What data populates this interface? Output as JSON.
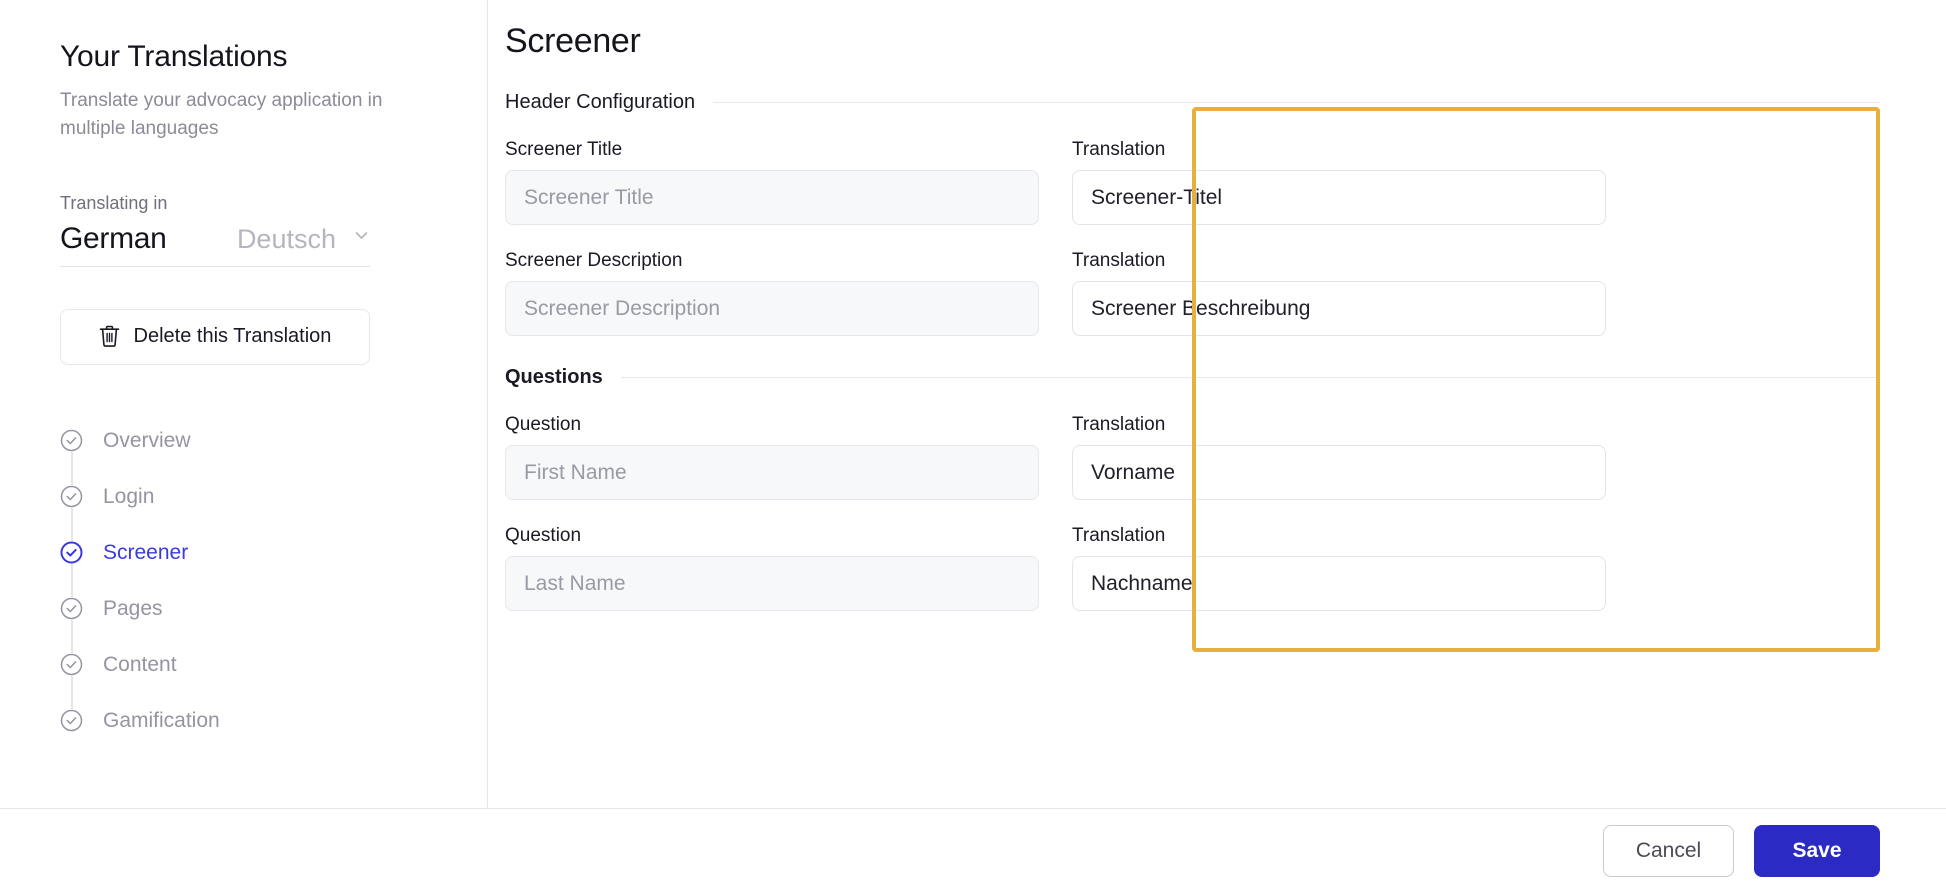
{
  "sidebar": {
    "title": "Your Translations",
    "subtitle": "Translate your advocacy application in multiple languages",
    "translating_label": "Translating in",
    "language": {
      "name": "German",
      "native": "Deutsch",
      "chevron_icon": "chevron-down-icon"
    },
    "delete_button": {
      "label": "Delete this Translation",
      "icon": "trash-icon"
    },
    "nav_items": [
      {
        "label": "Overview",
        "icon": "check-circle-icon",
        "active": false
      },
      {
        "label": "Login",
        "icon": "check-circle-icon",
        "active": false
      },
      {
        "label": "Screener",
        "icon": "check-circle-icon",
        "active": true
      },
      {
        "label": "Pages",
        "icon": "check-circle-icon",
        "active": false
      },
      {
        "label": "Content",
        "icon": "check-circle-icon",
        "active": false
      },
      {
        "label": "Gamification",
        "icon": "check-circle-icon",
        "active": false
      }
    ]
  },
  "main": {
    "page_title": "Screener",
    "sections": [
      {
        "heading": "Header Configuration",
        "bold": false
      },
      {
        "heading": "Questions",
        "bold": true
      }
    ],
    "header_rows": [
      {
        "source_label": "Screener Title",
        "source_placeholder": "Screener Title",
        "source_value": "",
        "translation_label": "Translation",
        "translation_value": "Screener-Titel"
      },
      {
        "source_label": "Screener Description",
        "source_placeholder": "Screener Description",
        "source_value": "",
        "translation_label": "Translation",
        "translation_value": "Screener Beschreibung"
      }
    ],
    "question_rows": [
      {
        "source_label": "Question",
        "source_placeholder": "First Name",
        "source_value": "",
        "translation_label": "Translation",
        "translation_value": "Vorname"
      },
      {
        "source_label": "Question",
        "source_placeholder": "Last Name",
        "source_value": "",
        "translation_label": "Translation",
        "translation_value": "Nachname"
      }
    ]
  },
  "footer": {
    "cancel_label": "Cancel",
    "save_label": "Save"
  },
  "colors": {
    "accent_blue": "#3a3ae0",
    "save_blue": "#2b2bc4",
    "highlight_orange": "#e8ae3e",
    "muted_text": "#9595a1",
    "border": "#e6e6ec"
  }
}
